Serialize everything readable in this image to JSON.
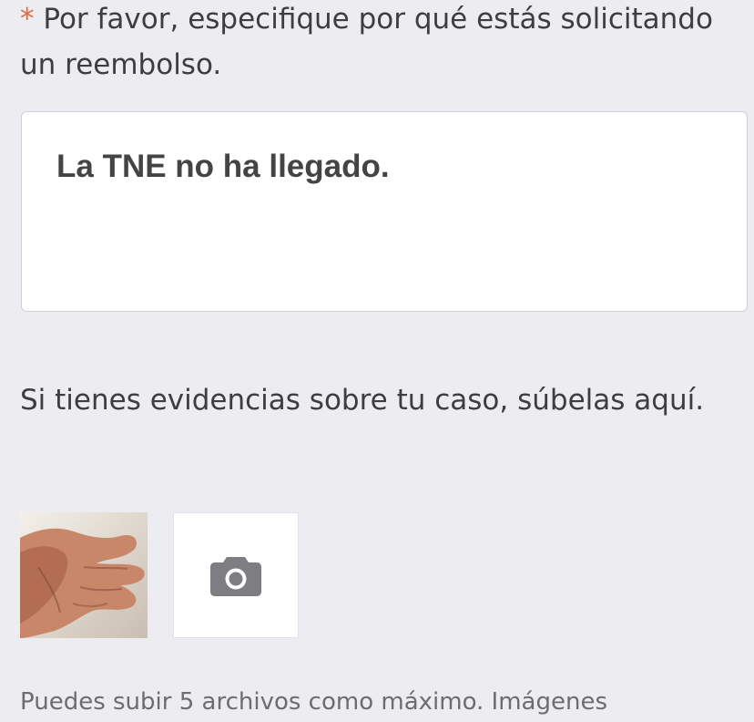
{
  "question": {
    "required_marker": "*",
    "label": "Por favor, especifique por qué estás solicitando un reembolso."
  },
  "reason_field": {
    "value": "La TNE no ha llegado."
  },
  "evidence": {
    "prompt": "Si tienes evidencias sobre tu caso, súbelas aquí."
  },
  "uploads": {
    "thumbnail_icon": "uploaded-photo-hand",
    "add_button_icon": "camera-icon"
  },
  "footer": {
    "note": "Puedes subir 5 archivos como máximo. Imágenes"
  },
  "colors": {
    "background": "#ececf1",
    "required_marker": "#e06a3a",
    "camera_icon": "#7d7d82"
  }
}
